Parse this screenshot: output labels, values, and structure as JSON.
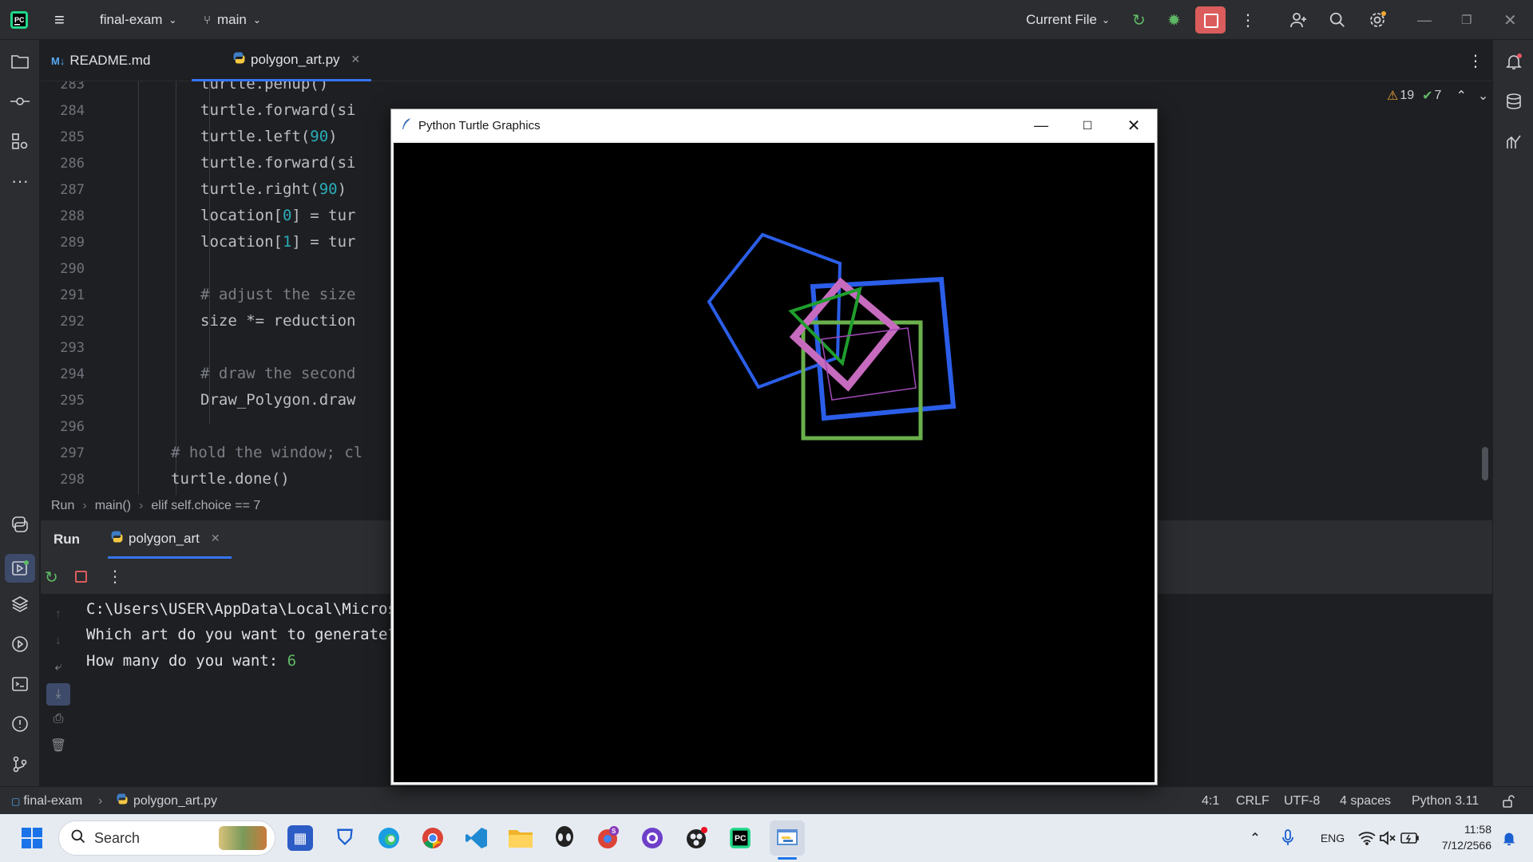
{
  "titlebar": {
    "project": "final-exam",
    "branch": "main",
    "run_config": "Current File"
  },
  "tabs": [
    {
      "label": "README.md",
      "prefix": "M↓"
    },
    {
      "label": "polygon_art.py",
      "active": true
    }
  ],
  "inspections": {
    "warnings": "19",
    "ok": "7"
  },
  "editor": {
    "lines": [
      {
        "n": "283",
        "code": "turtle.penup()"
      },
      {
        "n": "284",
        "code": "turtle.forward(si"
      },
      {
        "n": "285",
        "code": "turtle.left(",
        "num": "90",
        "tail": ")"
      },
      {
        "n": "286",
        "code": "turtle.forward(si"
      },
      {
        "n": "287",
        "code": "turtle.right(",
        "num": "90",
        "tail": ")"
      },
      {
        "n": "288",
        "code": "location[",
        "num": "0",
        "tail": "] = tur"
      },
      {
        "n": "289",
        "code": "location[",
        "num": "1",
        "tail": "] = tur"
      },
      {
        "n": "290",
        "code": ""
      },
      {
        "n": "291",
        "comment": "# adjust the size"
      },
      {
        "n": "292",
        "code": "size *= reduction"
      },
      {
        "n": "293",
        "code": ""
      },
      {
        "n": "294",
        "comment": "# draw the second"
      },
      {
        "n": "295",
        "code": "Draw_Polygon.draw"
      },
      {
        "n": "296",
        "code": ""
      },
      {
        "n": "297",
        "comment": "# hold the window; cl"
      },
      {
        "n": "298",
        "code": "turtle.done()"
      }
    ]
  },
  "breadcrumb": [
    "Run",
    "main()",
    "elif self.choice == 7"
  ],
  "run_panel": {
    "tab_run": "Run",
    "tab_file": "polygon_art",
    "console": [
      {
        "text": "C:\\Users\\USER\\AppData\\Local\\Microso"
      },
      {
        "text": "Which art do you want to generate?"
      },
      {
        "text": "How many do you want: ",
        "input": "6"
      }
    ]
  },
  "turtle_window": {
    "title": "Python Turtle Graphics"
  },
  "status": {
    "project": "final-exam",
    "file": "polygon_art.py",
    "position": "4:1",
    "line_sep": "CRLF",
    "encoding": "UTF-8",
    "indent": "4 spaces",
    "interpreter": "Python 3.11"
  },
  "taskbar": {
    "search_placeholder": "Search",
    "lang": "ENG",
    "time": "11:58",
    "date": "7/12/2566"
  }
}
